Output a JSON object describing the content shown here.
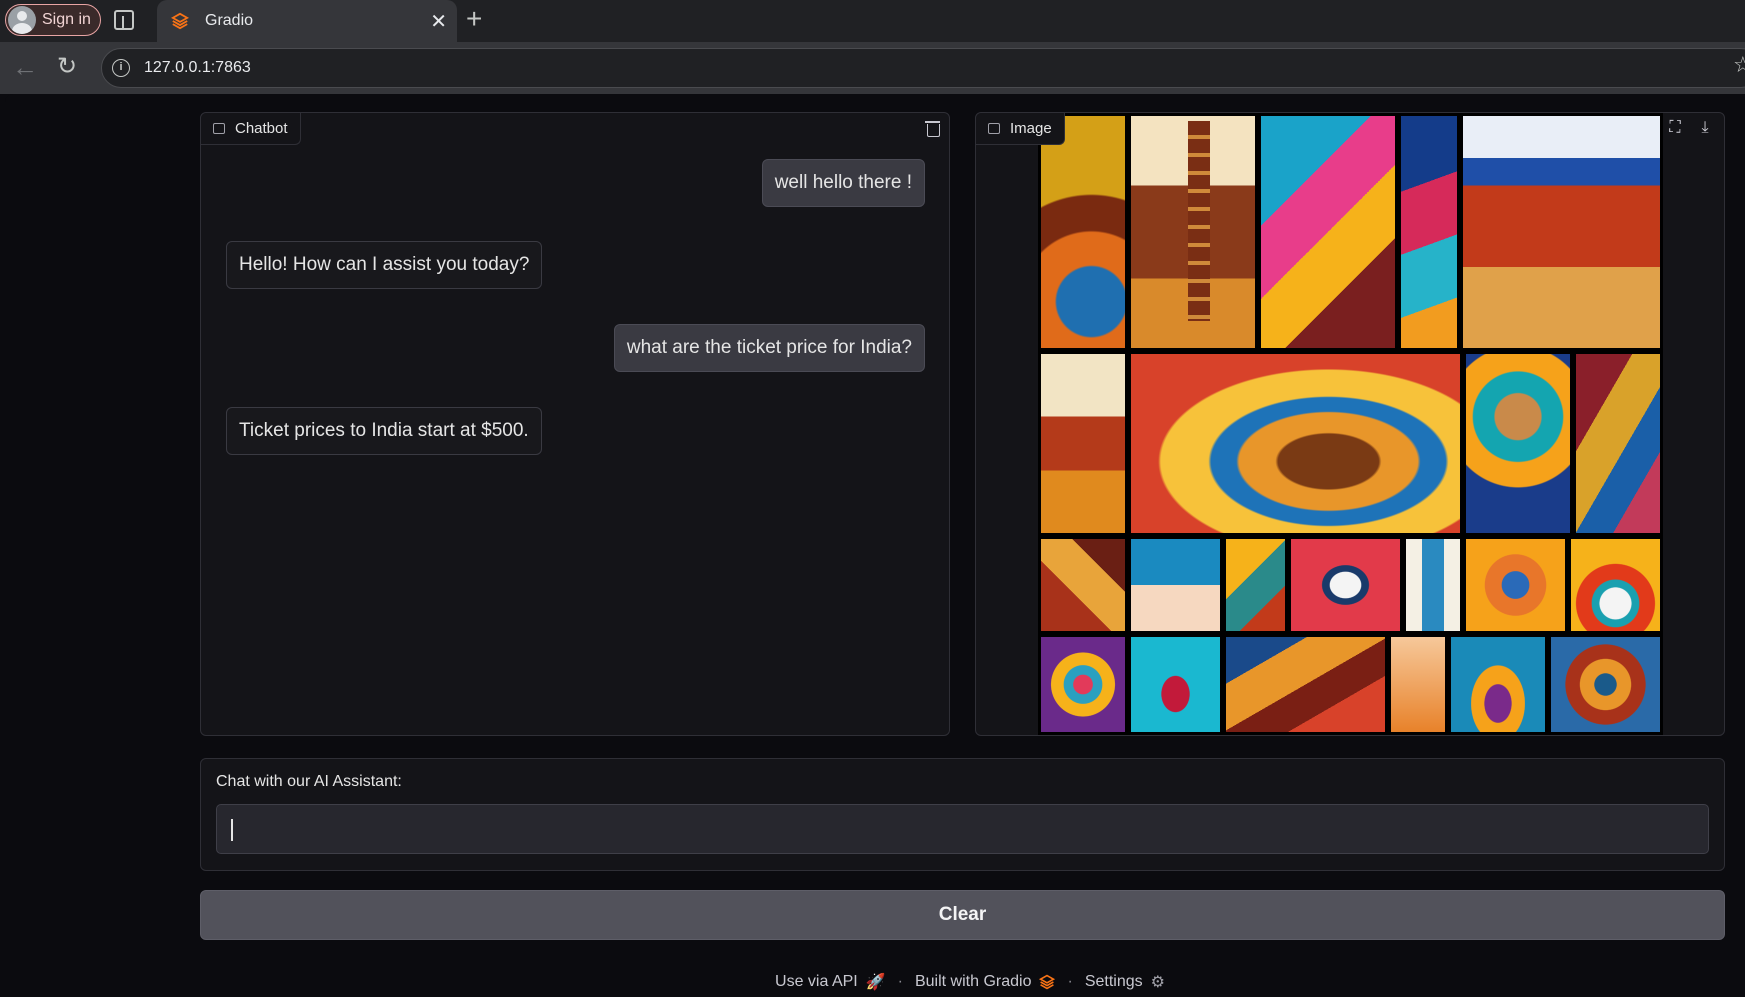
{
  "browser": {
    "signin_label": "Sign in",
    "tab_title": "Gradio",
    "tab_close": "✕",
    "new_tab": "+",
    "url": "127.0.0.1:7863"
  },
  "chatbot": {
    "label": "Chatbot",
    "messages": [
      {
        "role": "user",
        "text": "well hello there !"
      },
      {
        "role": "bot",
        "text": "Hello! How can I assist you today?"
      },
      {
        "role": "user",
        "text": "what are the ticket price for India?"
      },
      {
        "role": "bot",
        "text": "Ticket prices to India start at $500."
      }
    ]
  },
  "image": {
    "label": "Image",
    "fullscreen_icon": "fullscreen-icon",
    "download_icon": "download-icon"
  },
  "input": {
    "label": "Chat with our AI Assistant:",
    "value": ""
  },
  "clear_button": "Clear",
  "footer": {
    "api": "Use via API",
    "built": "Built with Gradio",
    "settings": "Settings"
  },
  "colors": {
    "accent_orange": "#f97316",
    "page_bg": "#0b0b0f",
    "block_bg": "#141418",
    "button_bg": "#52525b"
  }
}
